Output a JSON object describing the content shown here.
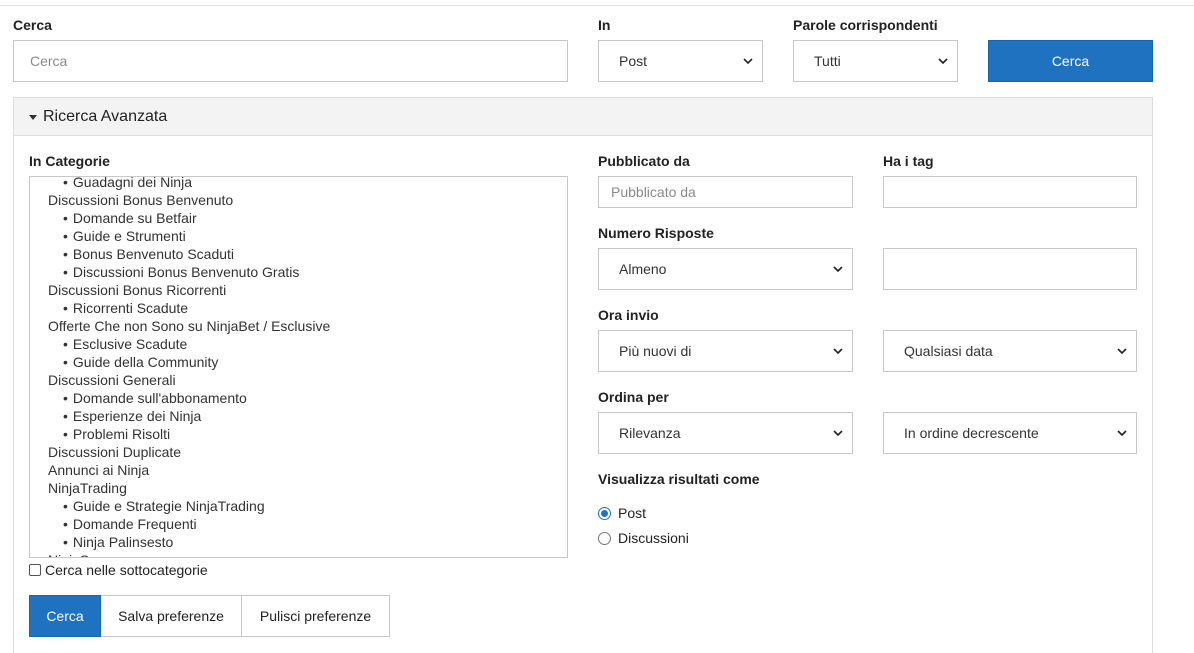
{
  "search": {
    "label": "Cerca",
    "placeholder": "Cerca",
    "in_label": "In",
    "in_value": "Post",
    "match_label": "Parole corrispondenti",
    "match_value": "Tutti",
    "button": "Cerca"
  },
  "advanced": {
    "title": "Ricerca Avanzata",
    "categories_label": "In Categorie",
    "categories": [
      {
        "label": "Guadagni dei Ninja",
        "level": 1
      },
      {
        "label": "Discussioni Bonus Benvenuto",
        "level": 0
      },
      {
        "label": "Domande su Betfair",
        "level": 1
      },
      {
        "label": "Guide e Strumenti",
        "level": 1
      },
      {
        "label": "Bonus Benvenuto Scaduti",
        "level": 1
      },
      {
        "label": "Discussioni Bonus Benvenuto Gratis",
        "level": 1
      },
      {
        "label": "Discussioni Bonus Ricorrenti",
        "level": 0
      },
      {
        "label": "Ricorrenti Scadute",
        "level": 1
      },
      {
        "label": "Offerte Che non Sono su NinjaBet / Esclusive",
        "level": 0
      },
      {
        "label": "Esclusive Scadute",
        "level": 1
      },
      {
        "label": "Guide della Community",
        "level": 1
      },
      {
        "label": "Discussioni Generali",
        "level": 0
      },
      {
        "label": "Domande sull'abbonamento",
        "level": 1
      },
      {
        "label": "Esperienze dei Ninja",
        "level": 1
      },
      {
        "label": "Problemi Risolti",
        "level": 1
      },
      {
        "label": "Discussioni Duplicate",
        "level": 0
      },
      {
        "label": "Annunci ai Ninja",
        "level": 0
      },
      {
        "label": "NinjaTrading",
        "level": 0
      },
      {
        "label": "Guide e Strategie NinjaTrading",
        "level": 1
      },
      {
        "label": "Domande Frequenti",
        "level": 1
      },
      {
        "label": "Ninja Palinsesto",
        "level": 1
      },
      {
        "label": "NinjaSure",
        "level": 0
      }
    ],
    "subcategories_label": "Cerca nelle sottocategorie",
    "posted_by_label": "Pubblicato da",
    "posted_by_placeholder": "Pubblicato da",
    "tags_label": "Ha i tag",
    "tags_value": "",
    "replies_label": "Numero Risposte",
    "replies_mode": "Almeno",
    "replies_value": "",
    "time_label": "Ora invio",
    "time_mode": "Più nuovi di",
    "time_range": "Qualsiasi data",
    "sort_label": "Ordina per",
    "sort_by": "Rilevanza",
    "sort_order": "In ordine decrescente",
    "display_label": "Visualizza risultati come",
    "display_options": [
      "Post",
      "Discussioni"
    ],
    "buttons": {
      "search": "Cerca",
      "save": "Salva preferenze",
      "clear": "Pulisci preferenze"
    }
  },
  "colors": {
    "accent": "#1f72c0",
    "panel_header": "#f3f3f3",
    "border": "#c8c8c8"
  }
}
